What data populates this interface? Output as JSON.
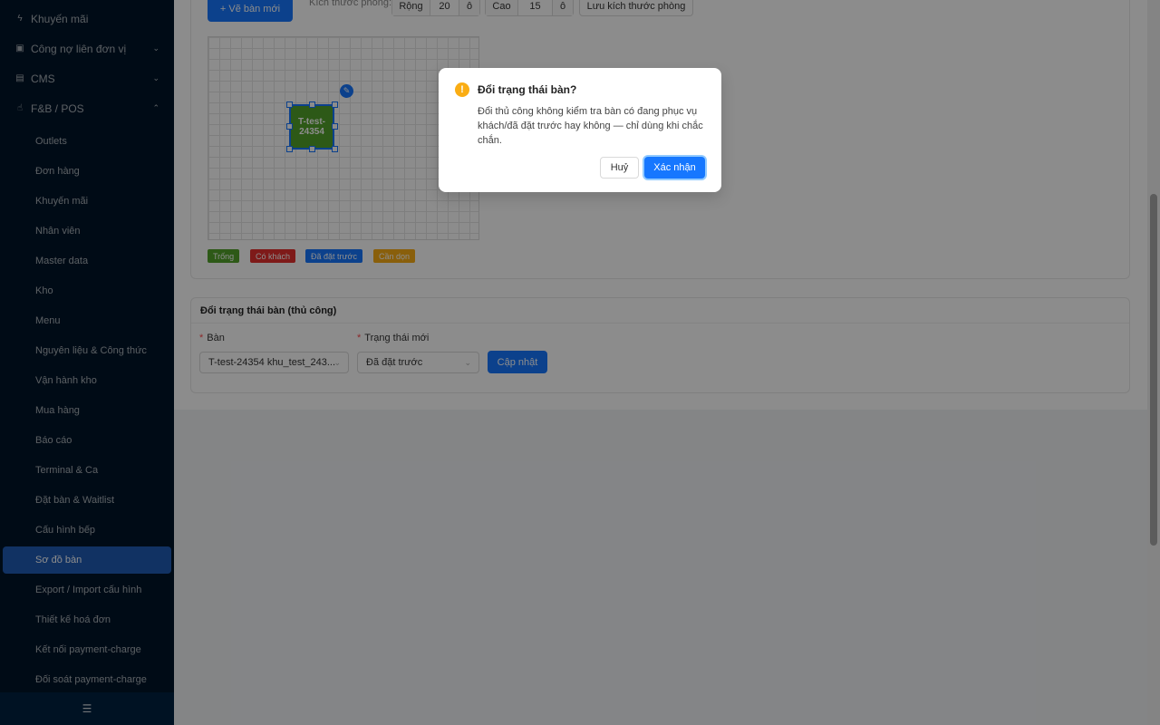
{
  "sidebar": {
    "top_items": [
      {
        "label": "Khuyến mãi",
        "icon": "lightning-icon",
        "chevron": ""
      },
      {
        "label": "Công nợ liên đơn vị",
        "icon": "ledger-icon",
        "chevron": "⌄"
      },
      {
        "label": "CMS",
        "icon": "document-icon",
        "chevron": "⌄"
      },
      {
        "label": "F&B / POS",
        "icon": "hand-icon",
        "chevron": "⌃"
      }
    ],
    "sub_items": [
      "Outlets",
      "Đơn hàng",
      "Khuyến mãi",
      "Nhân viên",
      "Master data",
      "Kho",
      "Menu",
      "Nguyên liệu & Công thức",
      "Vận hành kho",
      "Mua hàng",
      "Báo cáo",
      "Terminal & Ca",
      "Đặt bàn & Waitlist",
      "Cấu hình bếp",
      "Sơ đồ bàn",
      "Export / Import cấu hình",
      "Thiết kế hoá đơn",
      "Kết nối payment-charge",
      "Đối soát payment-charge"
    ],
    "active_sub": "Sơ đồ bàn",
    "footer_icon": "menu-fold-icon"
  },
  "toolbar": {
    "new_table_label": "+ Vẽ bàn mới",
    "room_size_label": "Kích thước phòng:",
    "width_label": "Rộng",
    "width_value": "20",
    "width_unit": "ô",
    "height_label": "Cao",
    "height_value": "15",
    "height_unit": "ô",
    "save_size_label": "Lưu kích thước phòng"
  },
  "canvas": {
    "table_label": "T-test-24354"
  },
  "legend": [
    {
      "label": "Trống",
      "color": "#52a32a"
    },
    {
      "label": "Có khách",
      "color": "#e5302f"
    },
    {
      "label": "Đã đặt trước",
      "color": "#1677ff"
    },
    {
      "label": "Cần dọn",
      "color": "#faad14"
    }
  ],
  "manual_status": {
    "title": "Đổi trạng thái bàn (thủ công)",
    "table_field_label": "Bàn",
    "table_field_value": "T-test-24354 khu_test_243...",
    "status_field_label": "Trạng thái mới",
    "status_field_value": "Đã đặt trước",
    "update_label": "Cập nhật"
  },
  "modal": {
    "title": "Đổi trạng thái bàn?",
    "body": "Đổi thủ công không kiểm tra bàn có đang phục vụ khách/đã đặt trước hay không — chỉ dùng khi chắc chắn.",
    "cancel_label": "Huỷ",
    "confirm_label": "Xác nhận"
  }
}
